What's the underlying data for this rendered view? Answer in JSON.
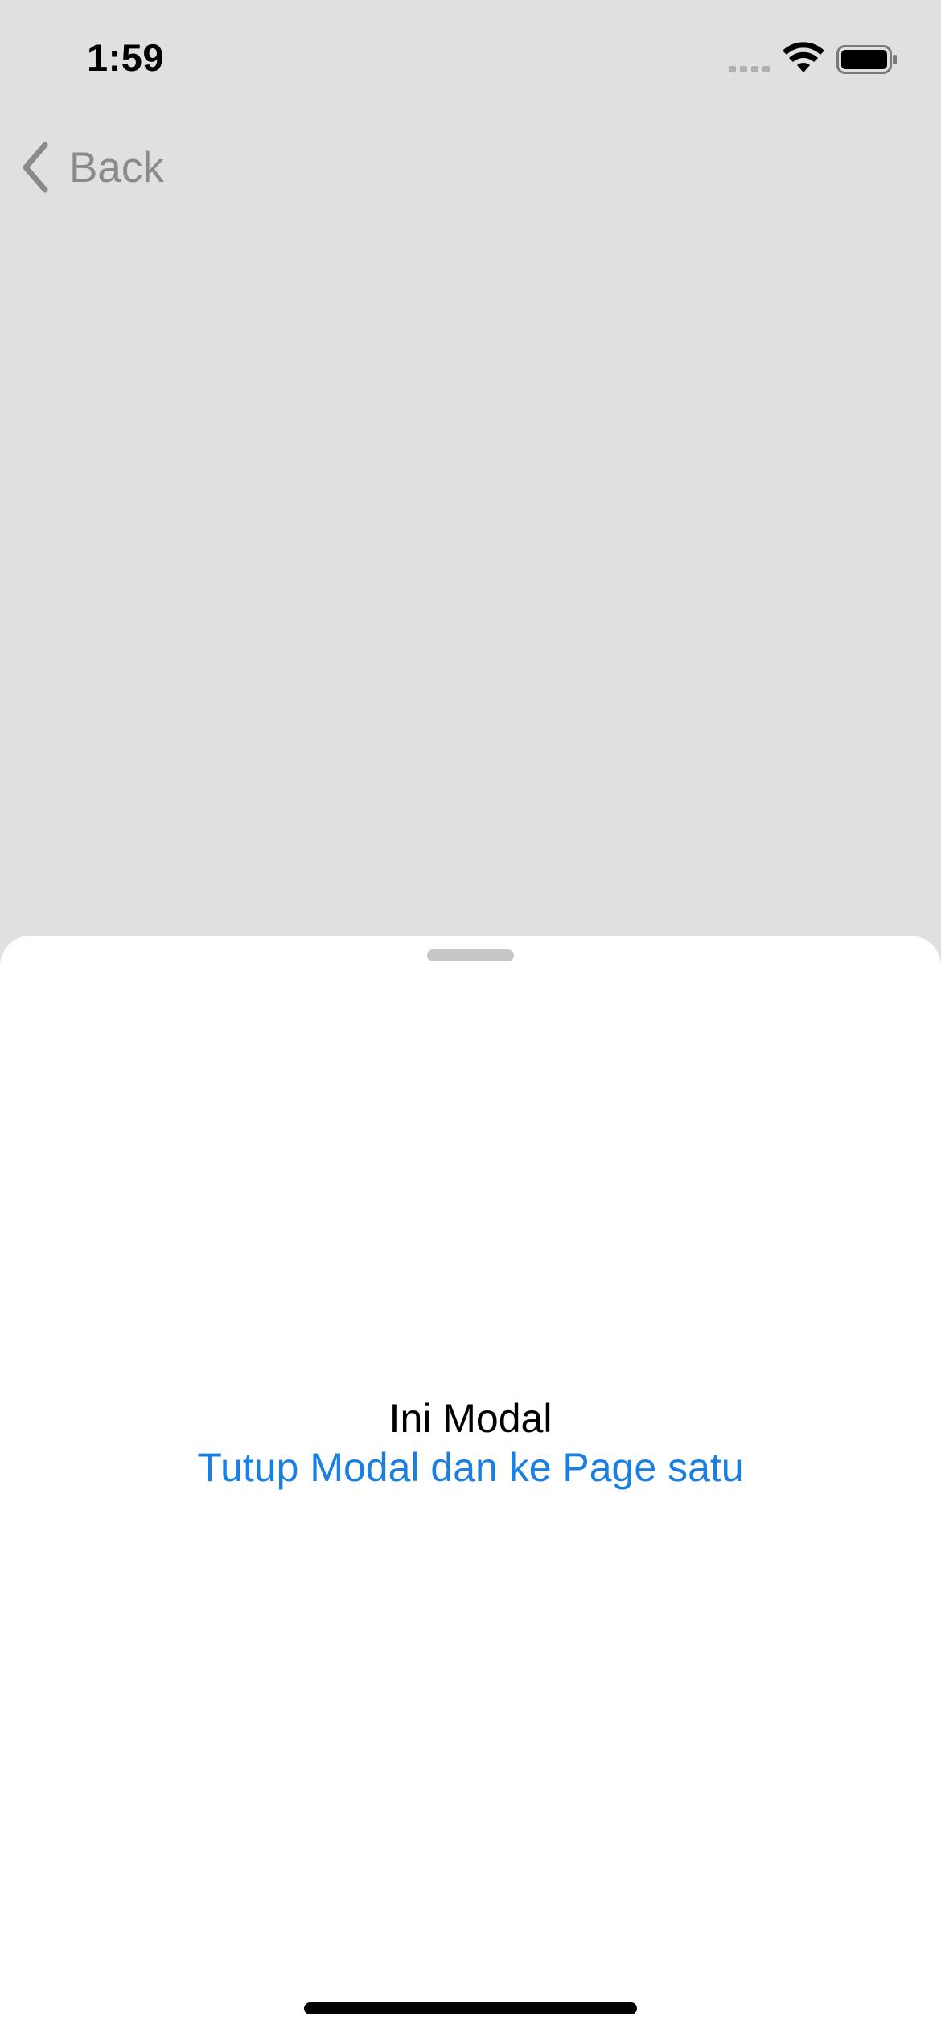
{
  "status_bar": {
    "time": "1:59",
    "icons": [
      "cellular-signal-icon",
      "wifi-icon",
      "battery-icon"
    ]
  },
  "nav": {
    "back_label": "Back",
    "back_icon": "chevron-left-icon"
  },
  "modal": {
    "title": "Ini Modal",
    "link_label": "Tutup Modal dan ke Page satu",
    "link_color": "#1a7fe0"
  },
  "colors": {
    "background_dimmed": "#e0e0e0",
    "sheet": "#ffffff",
    "back_text": "#8a8a8a"
  }
}
